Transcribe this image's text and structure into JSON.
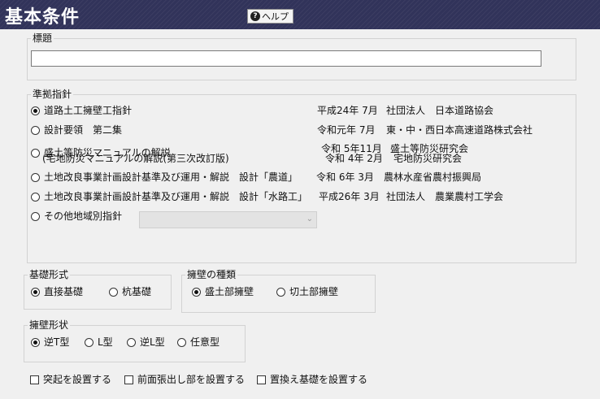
{
  "header": {
    "title": "基本条件",
    "help_label": "ヘルプ",
    "help_icon": "?"
  },
  "title_group": {
    "legend": "標題",
    "value": ""
  },
  "standard_group": {
    "legend": "準拠指針",
    "options": [
      {
        "label": "道路土工擁壁工指針",
        "date": "平成24年 7月",
        "publisher": "社団法人　日本道路協会",
        "selected": true
      },
      {
        "label": "設計要領　第二集",
        "date": "令和元年 7月",
        "publisher": "東・中・西日本高速道路株式会社",
        "selected": false
      },
      {
        "label": "盛土等防災マニュアルの解説",
        "label2": "(宅地防災マニュアルの解説(第三次改訂版)",
        "date": "令和 5年11月",
        "publisher": "盛土等防災研究会",
        "date2": "令和 4年 2月",
        "publisher2": "宅地防災研究会",
        "selected": false
      },
      {
        "label": "土地改良事業計画設計基準及び運用・解説　設計「農道」",
        "date": "令和 6年 3月",
        "publisher": "農林水産省農村振興局",
        "selected": false
      },
      {
        "label": "土地改良事業計画設計基準及び運用・解説　設計「水路工」",
        "date": "平成26年 3月",
        "publisher": "社団法人　農業農村工学会",
        "selected": false
      },
      {
        "label": "その他地域別指針",
        "selected": false,
        "select_value": ""
      }
    ]
  },
  "foundation_group": {
    "legend": "基礎形式",
    "options": [
      {
        "label": "直接基礎",
        "selected": true
      },
      {
        "label": "杭基礎",
        "selected": false
      }
    ]
  },
  "wall_type_group": {
    "legend": "擁壁の種類",
    "options": [
      {
        "label": "盛土部擁壁",
        "selected": true
      },
      {
        "label": "切土部擁壁",
        "selected": false
      }
    ]
  },
  "wall_shape_group": {
    "legend": "擁壁形状",
    "options": [
      {
        "label": "逆T型",
        "selected": true
      },
      {
        "label": "L型",
        "selected": false
      },
      {
        "label": "逆L型",
        "selected": false
      },
      {
        "label": "任意型",
        "selected": false
      }
    ]
  },
  "checkboxes": [
    {
      "label": "突起を設置する",
      "checked": false
    },
    {
      "label": "前面張出し部を設置する",
      "checked": false
    },
    {
      "label": "置換え基礎を設置する",
      "checked": false
    }
  ]
}
